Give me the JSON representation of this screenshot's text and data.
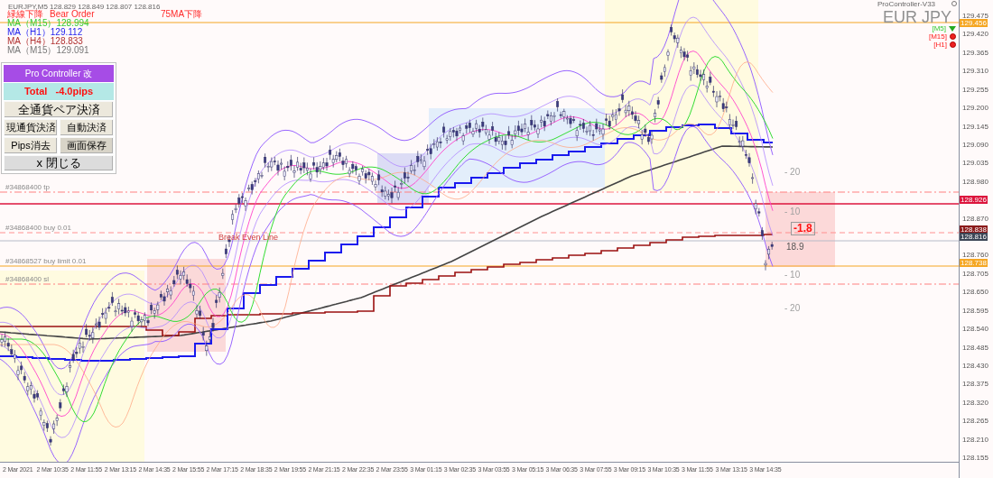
{
  "symbol_header": "EURJPY,M5  128.829 128.849 128.807 128.816",
  "signals": [
    {
      "text": "緑線下降"
    },
    {
      "text": "Bear Order"
    },
    {
      "text": "75MA下降"
    }
  ],
  "ma_readouts": [
    {
      "text": "MA（M15）128.994",
      "color": "#33cc33"
    },
    {
      "text": "MA（H1）129.112",
      "color": "#2222ee"
    },
    {
      "text": "MA（H4）128.833",
      "color": "#b03030"
    },
    {
      "text": "MA（M15）129.091",
      "color": "#777777"
    }
  ],
  "panel": {
    "title": "Pro Controller 改",
    "total": "Total   -4.0pips",
    "buttons": [
      {
        "label": "全通貨ペア決済",
        "kind": "wide",
        "pressed": false
      },
      {
        "label": "現通貨決済",
        "kind": "half",
        "pressed": false
      },
      {
        "label": "自動決済",
        "kind": "half",
        "pressed": false
      },
      {
        "label": "Pips消去",
        "kind": "half",
        "pressed": false
      },
      {
        "label": "画面保存",
        "kind": "half",
        "pressed": true
      },
      {
        "label": "x 閉じる",
        "kind": "close",
        "pressed": false
      }
    ]
  },
  "instrument": "EUR JPY",
  "indicator_name": "ProController-V33",
  "timeframe_signals": [
    {
      "label": "[M5]",
      "kind": "bull"
    },
    {
      "label": "[M15]",
      "kind": "bear"
    },
    {
      "label": "[H1]",
      "kind": "bear"
    }
  ],
  "order_lines": [
    {
      "label": "#34868400 tp",
      "kind": "tp"
    },
    {
      "label": "#34868400 buy 0.01",
      "kind": "entry"
    },
    {
      "label": "#34868527 buy limit 0.01",
      "kind": "limit"
    },
    {
      "label": "#34868400 sl",
      "kind": "sl"
    }
  ],
  "break_even_label": "Break Even Line",
  "profit": "-1.8",
  "distance": "18.9",
  "pips_marks": [
    "- 20",
    "- 10",
    "- 10",
    "- 20"
  ],
  "price_axis": [
    "129.475",
    "129.420",
    "129.365",
    "129.310",
    "129.255",
    "129.200",
    "129.145",
    "129.090",
    "129.035",
    "128.980",
    "128.870",
    "128.760",
    "128.705",
    "128.650",
    "128.595",
    "128.540",
    "128.485",
    "128.430",
    "128.375",
    "128.320",
    "128.265",
    "128.210",
    "128.155"
  ],
  "price_tags": [
    {
      "text": "129.456",
      "color": "#f5a623"
    },
    {
      "text": "128.926",
      "color": "#dc143c"
    },
    {
      "text": "128.838",
      "color": "#8b1a1a"
    },
    {
      "text": "128.816",
      "color": "#3c4656"
    },
    {
      "text": "128.738",
      "color": "#f5a623"
    }
  ],
  "time_axis": [
    "2 Mar 2021",
    "2 Mar 10:35",
    "2 Mar 11:55",
    "2 Mar 13:15",
    "2 Mar 14:35",
    "2 Mar 15:55",
    "2 Mar 17:15",
    "2 Mar 18:35",
    "2 Mar 19:55",
    "2 Mar 21:15",
    "2 Mar 22:35",
    "2 Mar 23:55",
    "3 Mar 01:15",
    "3 Mar 02:35",
    "3 Mar 03:55",
    "3 Mar 05:15",
    "3 Mar 06:35",
    "3 Mar 07:55",
    "3 Mar 09:15",
    "3 Mar 10:35",
    "3 Mar 11:55",
    "3 Mar 13:15",
    "3 Mar 14:35"
  ]
}
